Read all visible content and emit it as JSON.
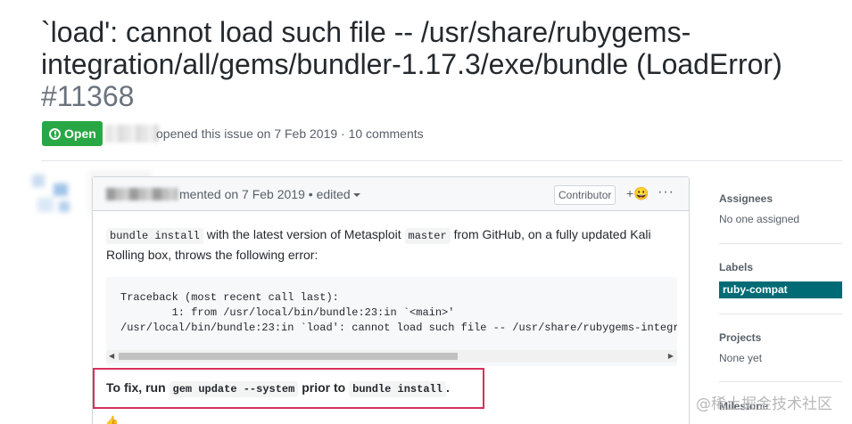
{
  "issue": {
    "title": "`load': cannot load such file -- /usr/share/rubygems-integration/all/gems/bundler-1.17.3/exe/bundle (LoadError)",
    "number": "#11368",
    "state_label": "Open",
    "meta_text": "opened this issue on 7 Feb 2019 · 10 comments"
  },
  "comment": {
    "header_text": "mented on 7 Feb 2019 • edited",
    "role_badge": "Contributor",
    "reaction_label": "+😀",
    "more_label": "···",
    "body": {
      "code1": "bundle install",
      "text1": " with the latest version of Metasploit ",
      "code2": "master",
      "text2": " from GitHub, on a fully updated Kali Rolling box, throws the following error:"
    },
    "code_block": "Traceback (most recent call last):\n        1: from /usr/local/bin/bundle:23:in `<main>'\n/usr/local/bin/bundle:23:in `load': cannot load such file -- /usr/share/rubygems-integr",
    "fix": {
      "prefix": "To fix, run ",
      "code1": "gem update --system",
      "middle": " prior to ",
      "code2": "bundle install",
      "suffix": "."
    }
  },
  "sidebar": {
    "assignees_title": "Assignees",
    "assignees_value": "No one assigned",
    "labels_title": "Labels",
    "label_name": "ruby-compat",
    "label_color": "#006b75",
    "projects_title": "Projects",
    "projects_value": "None yet",
    "milestone_title": "Milestone"
  },
  "watermark": "@稀土掘金技术社区",
  "colors": {
    "open_green": "#28a745",
    "highlight_border": "#d6315d"
  }
}
